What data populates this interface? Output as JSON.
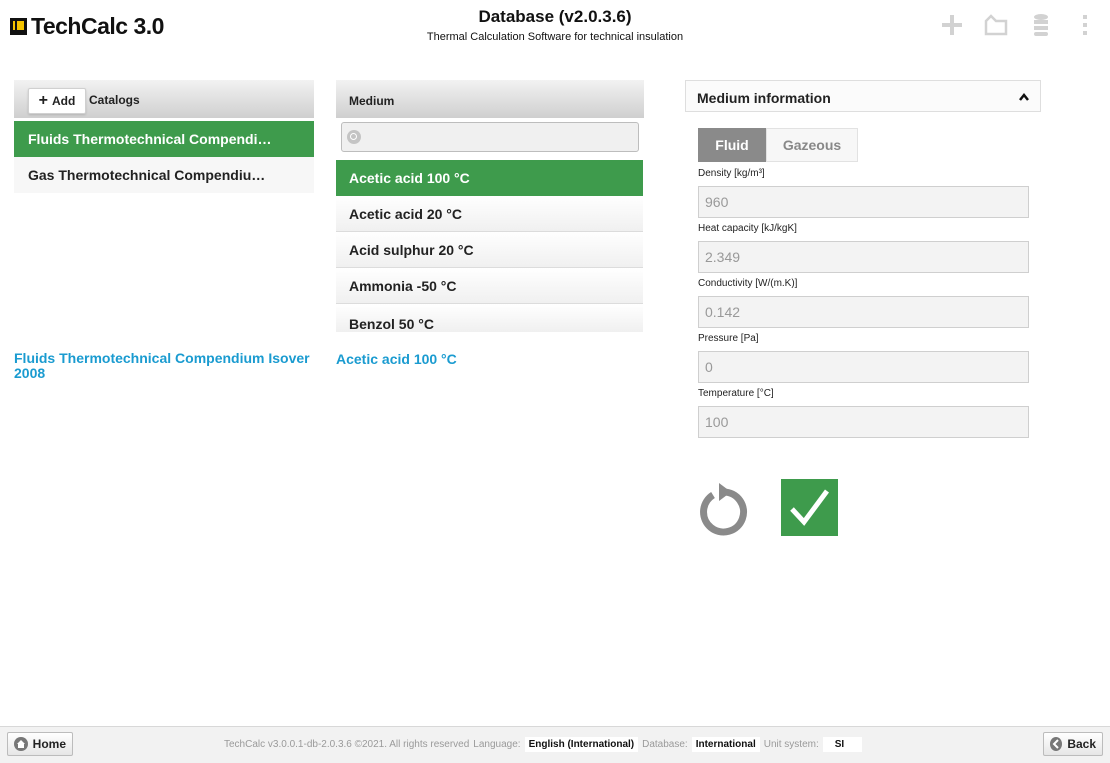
{
  "app": {
    "logo_text": "TechCalc 3.0",
    "title": "Database (v2.0.3.6)",
    "subtitle": "Thermal Calculation Software for technical insulation",
    "header_icons": [
      "plus-icon",
      "folder-icon",
      "database-icon",
      "more-vertical-icon"
    ]
  },
  "catalogs": {
    "add_label": "Add",
    "header": "Catalogs",
    "items": [
      {
        "label": "Fluids Thermotechnical Compendi…",
        "selected": true
      },
      {
        "label": "Gas Thermotechnical Compendiu…",
        "selected": false
      }
    ],
    "selected_full": "Fluids Thermotechnical Compendium Isover 2008"
  },
  "medium": {
    "header": "Medium",
    "search_value": "",
    "items": [
      {
        "label": "Acetic acid 100 °C",
        "selected": true
      },
      {
        "label": "Acetic acid 20 °C",
        "selected": false
      },
      {
        "label": "Acid sulphur 20 °C",
        "selected": false
      },
      {
        "label": "Ammonia -50 °C",
        "selected": false
      },
      {
        "label": "Benzol 50 °C",
        "selected": false
      }
    ],
    "selected_label": "Acetic acid 100 °C"
  },
  "info": {
    "title": "Medium information",
    "tabs": [
      {
        "label": "Fluid",
        "active": true
      },
      {
        "label": "Gazeous",
        "active": false
      }
    ],
    "fields": [
      {
        "label": "Density [kg/m³]",
        "value": "960"
      },
      {
        "label": "Heat capacity [kJ/kgK]",
        "value": "2.349"
      },
      {
        "label": "Conductivity [W/(m.K)]",
        "value": "0.142"
      },
      {
        "label": "Pressure [Pa]",
        "value": "0"
      },
      {
        "label": "Temperature [°C]",
        "value": "100"
      }
    ]
  },
  "footer": {
    "home_label": "Home",
    "back_label": "Back",
    "copyright": "TechCalc v3.0.0.1-db-2.0.3.6 ©2021. All rights reserved",
    "language_label": "Language:",
    "language_value": "English (International)",
    "database_label": "Database:",
    "database_value": "International",
    "unit_label": "Unit system:",
    "unit_value": "SI"
  },
  "colors": {
    "selected_green": "#3e9b4c",
    "link_blue": "#1a9bd0",
    "tab_active": "#8a8a8a"
  }
}
